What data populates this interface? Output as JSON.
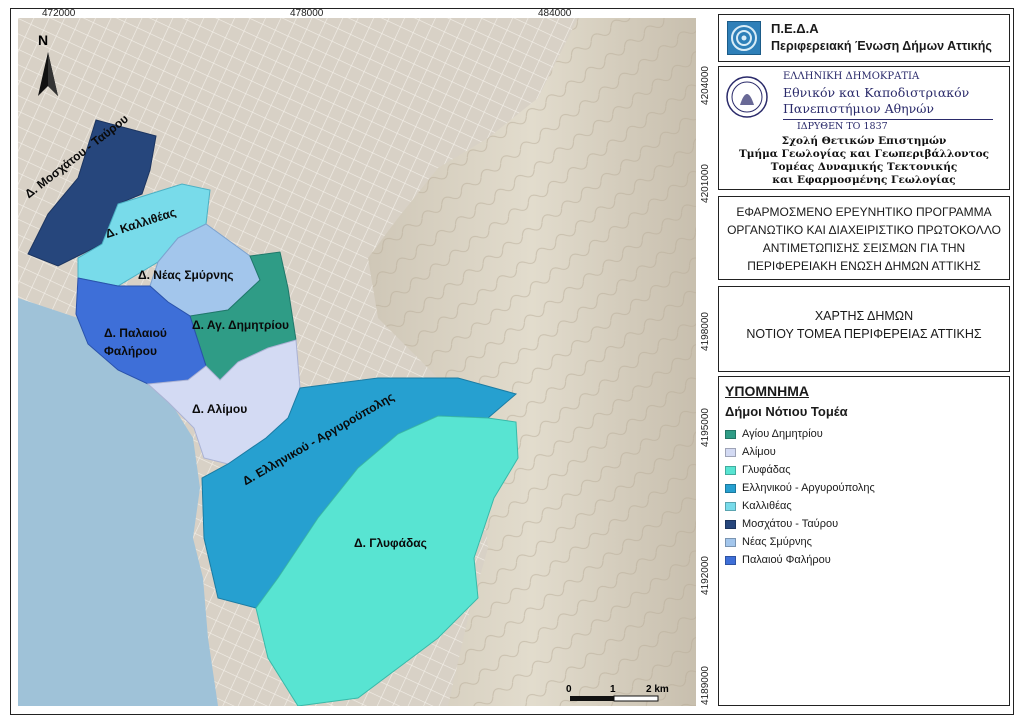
{
  "coordinates": {
    "top": [
      "472000",
      "478000",
      "484000"
    ],
    "right": [
      "4204000",
      "4201000",
      "4198000",
      "4195000",
      "4192000",
      "4189000"
    ]
  },
  "map": {
    "north_label": "N",
    "scale_labels": [
      "0",
      "1",
      "2 km"
    ],
    "municipality_labels": [
      "Δ. Μοσχάτου - Ταύρου",
      "Δ. Καλλιθέας",
      "Δ. Νέας Σμύρνης",
      "Δ. Αγ. Δημητρίου",
      "Δ. Παλαιού",
      "Φαλήρου",
      "Δ. Αλίμου",
      "Δ. Ελληνικού - Αργυρούπολης",
      "Δ. Γλυφάδας"
    ]
  },
  "header": {
    "org_title": "Π.Ε.Δ.Α",
    "org_subtitle": "Περιφερειακή Ένωση Δήμων Αττικής"
  },
  "university": {
    "line1": "ΕΛΛΗΝΙΚΗ ΔΗΜΟΚΡΑΤΙΑ",
    "line2": "Εθνικόν και Καποδιστριακόν",
    "line3": "Πανεπιστήμιον Αθηνών",
    "line4": "ΙΔΡΥΘΕΝ ΤΟ 1837",
    "dept1": "Σχολή Θετικών Επιστημών",
    "dept2": "Τμήμα Γεωλογίας και Γεωπεριβάλλοντος",
    "dept3": "Τομέας Δυναμικής Τεκτονικής",
    "dept4": "και Εφαρμοσμένης Γεωλογίας"
  },
  "program": {
    "line1": "ΕΦΑΡΜΟΣΜΕΝΟ ΕΡΕΥΝΗΤΙΚΟ ΠΡΟΓΡΑΜΜΑ",
    "line2": "ΟΡΓΑΝΩΤΙΚΟ ΚΑΙ ΔΙΑΧΕΙΡΙΣΤΙΚΟ ΠΡΩΤΟΚΟΛΛΟ",
    "line3": "ΑΝΤΙΜΕΤΩΠΙΣΗΣ ΣΕΙΣΜΩΝ ΓΙΑ ΤΗΝ",
    "line4": "ΠΕΡΙΦΕΡΕΙΑΚΗ ΕΝΩΣΗ ΔΗΜΩΝ ΑΤΤΙΚΗΣ"
  },
  "map_title": {
    "line1": "ΧΑΡΤΗΣ ΔΗΜΩΝ",
    "line2": "ΝΟΤΙΟΥ ΤΟΜΕΑ ΠΕΡΙΦΕΡΕΙΑΣ ΑΤΤΙΚΗΣ"
  },
  "legend": {
    "title": "ΥΠΟΜΝΗΜΑ",
    "subtitle": "Δήμοι Νότιου Τομέα",
    "items": [
      {
        "label": "Αγίου Δημητρίου",
        "color": "#2f9c86"
      },
      {
        "label": "Αλίμου",
        "color": "#d3daf3"
      },
      {
        "label": "Γλυφάδας",
        "color": "#58e4d2"
      },
      {
        "label": "Ελληνικού - Αργυρούπολης",
        "color": "#26a0d0"
      },
      {
        "label": "Καλλιθέας",
        "color": "#78dbea"
      },
      {
        "label": "Μοσχάτου - Ταύρου",
        "color": "#26467c"
      },
      {
        "label": "Νέας Σμύρνης",
        "color": "#a3c6ec"
      },
      {
        "label": "Παλαιού Φαλήρου",
        "color": "#3e6fd8"
      }
    ]
  }
}
